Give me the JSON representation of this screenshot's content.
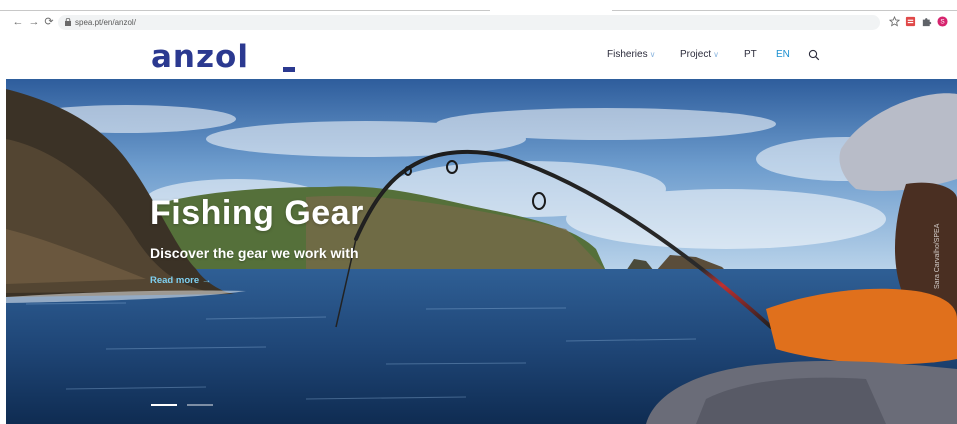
{
  "browser": {
    "url": "spea.pt/en/anzol/",
    "back_icon": "arrow-left-icon",
    "forward_icon": "arrow-right-icon",
    "reload_icon": "reload-icon",
    "lock_icon": "lock-icon",
    "star_icon": "star-icon",
    "extension_icon": "extension-icon",
    "puzzle_icon": "puzzle-icon",
    "profile_initial": "S"
  },
  "header": {
    "logo": "anzol",
    "menu": [
      {
        "label": "Fisheries",
        "has_dropdown": true
      },
      {
        "label": "Project",
        "has_dropdown": true
      },
      {
        "label": "PT",
        "has_dropdown": false
      },
      {
        "label": "EN",
        "has_dropdown": false,
        "active": true
      }
    ],
    "search_icon": "search-icon"
  },
  "hero": {
    "title": "Fishing Gear",
    "subtitle": "Discover the gear we work with",
    "read_more": "Read more →",
    "photo_credit": "Sara Carvalho/SPEA",
    "slides": [
      {
        "active": true
      },
      {
        "active": false
      }
    ]
  },
  "colors": {
    "brand": "#2b3990",
    "accent": "#1a8fd0",
    "link": "#7fd0f0"
  }
}
